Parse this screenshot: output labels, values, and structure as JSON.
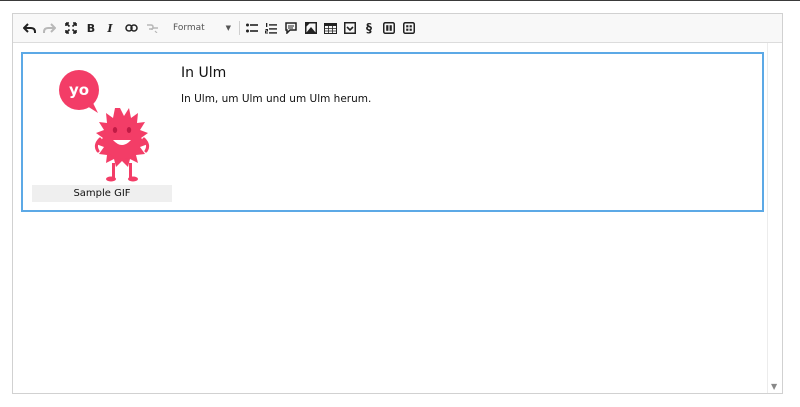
{
  "toolbar": {
    "buttons": [
      {
        "name": "undo",
        "state": "enabled"
      },
      {
        "name": "redo",
        "state": "disabled"
      },
      {
        "name": "maximize",
        "state": "enabled"
      },
      {
        "name": "bold",
        "label": "B",
        "state": "enabled"
      },
      {
        "name": "italic",
        "label": "I",
        "state": "enabled"
      },
      {
        "name": "link",
        "state": "enabled"
      },
      {
        "name": "unlink",
        "state": "disabled"
      }
    ],
    "format_label": "Format",
    "insert_buttons": [
      "bulleted-list",
      "numbered-list",
      "comment",
      "image",
      "table",
      "checkbox",
      "section-sign",
      "widget-grid",
      "widget-grid-2"
    ],
    "section_sign": "§"
  },
  "content": {
    "heading": "In Ulm",
    "paragraph": "In Ulm, um Ulm und um Ulm herum.",
    "image": {
      "bubble_text": "yo",
      "caption": "Sample GIF",
      "color": "#f33d67"
    }
  },
  "colors": {
    "selection_border": "#5ca9e6",
    "caption_bg": "#efefef",
    "toolbar_bg": "#f8f8f8"
  }
}
